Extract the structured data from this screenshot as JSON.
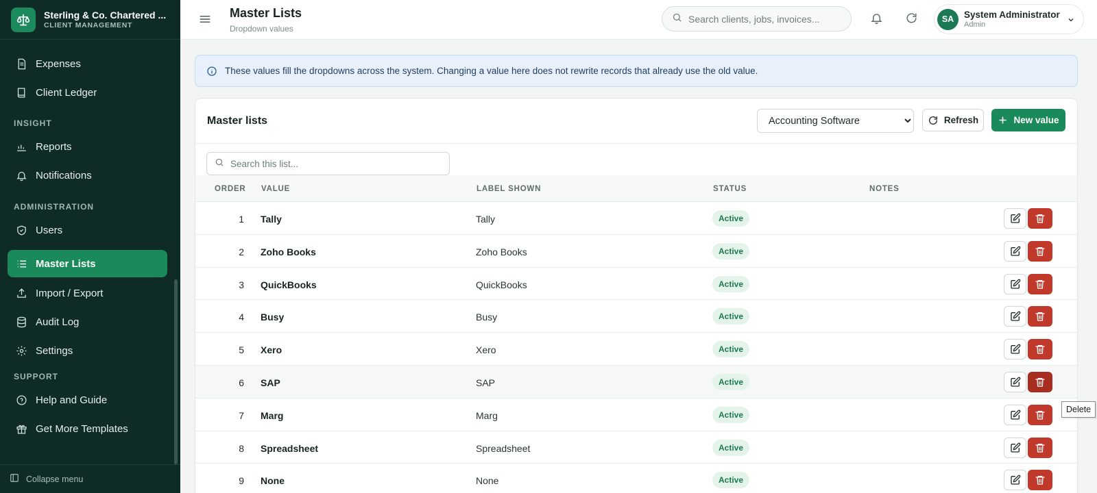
{
  "brand": {
    "name": "Sterling & Co. Chartered ...",
    "subtitle": "CLIENT MANAGEMENT"
  },
  "sidebar": {
    "items": [
      {
        "label": "Expenses",
        "icon": "receipt-icon"
      },
      {
        "label": "Client Ledger",
        "icon": "book-icon"
      },
      {
        "label": "Reports",
        "icon": "bar-chart-icon"
      },
      {
        "label": "Notifications",
        "icon": "bell-icon"
      },
      {
        "label": "Users",
        "icon": "shield-icon"
      },
      {
        "label": "Master Lists",
        "icon": "list-icon",
        "active": true
      },
      {
        "label": "Import / Export",
        "icon": "upload-icon"
      },
      {
        "label": "Audit Log",
        "icon": "database-icon"
      },
      {
        "label": "Settings",
        "icon": "gear-icon"
      },
      {
        "label": "Help and Guide",
        "icon": "help-circle-icon"
      },
      {
        "label": "Get More Templates",
        "icon": "gift-icon"
      }
    ],
    "sections": {
      "insight": "INSIGHT",
      "administration": "ADMINISTRATION",
      "support": "SUPPORT"
    },
    "collapse_label": "Collapse menu"
  },
  "header": {
    "title": "Master Lists",
    "subtitle": "Dropdown values",
    "search_placeholder": "Search clients, jobs, invoices...",
    "user": {
      "initials": "SA",
      "name": "System Administrator",
      "role": "Admin"
    }
  },
  "banner": {
    "text": "These values fill the dropdowns across the system. Changing a value here does not rewrite records that already use the old value."
  },
  "card": {
    "title": "Master lists",
    "selected_list": "Accounting Software",
    "refresh_label": "Refresh",
    "new_label": "New value",
    "search_placeholder": "Search this list..."
  },
  "table": {
    "columns": {
      "order": "ORDER",
      "value": "VALUE",
      "label": "LABEL SHOWN",
      "status": "STATUS",
      "notes": "NOTES"
    },
    "rows": [
      {
        "order": "1",
        "value": "Tally",
        "label": "Tally",
        "status": "Active",
        "notes": ""
      },
      {
        "order": "2",
        "value": "Zoho Books",
        "label": "Zoho Books",
        "status": "Active",
        "notes": ""
      },
      {
        "order": "3",
        "value": "QuickBooks",
        "label": "QuickBooks",
        "status": "Active",
        "notes": ""
      },
      {
        "order": "4",
        "value": "Busy",
        "label": "Busy",
        "status": "Active",
        "notes": ""
      },
      {
        "order": "5",
        "value": "Xero",
        "label": "Xero",
        "status": "Active",
        "notes": ""
      },
      {
        "order": "6",
        "value": "SAP",
        "label": "SAP",
        "status": "Active",
        "notes": ""
      },
      {
        "order": "7",
        "value": "Marg",
        "label": "Marg",
        "status": "Active",
        "notes": ""
      },
      {
        "order": "8",
        "value": "Spreadsheet",
        "label": "Spreadsheet",
        "status": "Active",
        "notes": ""
      },
      {
        "order": "9",
        "value": "None",
        "label": "None",
        "status": "Active",
        "notes": ""
      }
    ]
  },
  "tooltip": {
    "text": "Delete"
  },
  "colors": {
    "sidebar_bg": "#0e2b26",
    "accent": "#1b8a5a",
    "danger": "#c0392b",
    "status_bg": "#e4f4ea",
    "status_text": "#1a7a4c",
    "banner_bg": "#e8f1fb"
  }
}
